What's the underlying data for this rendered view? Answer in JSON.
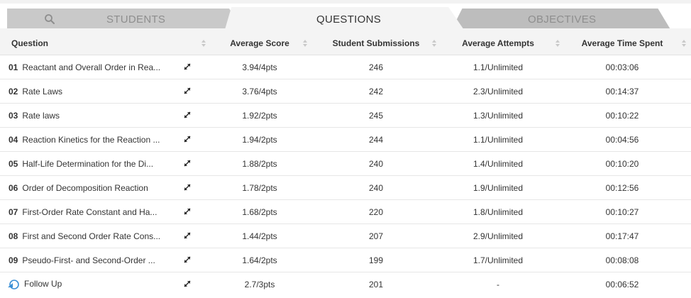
{
  "tabs": {
    "students": "STUDENTS",
    "questions": "QUESTIONS",
    "objectives": "OBJECTIVES"
  },
  "table": {
    "headers": {
      "question": "Question",
      "average_score": "Average Score",
      "student_submissions": "Student Submissions",
      "average_attempts": "Average Attempts",
      "average_time_spent": "Average Time Spent"
    },
    "rows": [
      {
        "num": "01",
        "title": "Reactant and Overall Order in Rea...",
        "score": "3.94/4pts",
        "submissions": "246",
        "attempts": "1.1/Unlimited",
        "time": "00:03:06"
      },
      {
        "num": "02",
        "title": "Rate Laws",
        "score": "3.76/4pts",
        "submissions": "242",
        "attempts": "2.3/Unlimited",
        "time": "00:14:37"
      },
      {
        "num": "03",
        "title": "Rate laws",
        "score": "1.92/2pts",
        "submissions": "245",
        "attempts": "1.3/Unlimited",
        "time": "00:10:22"
      },
      {
        "num": "04",
        "title": "Reaction Kinetics for the Reaction ...",
        "score": "1.94/2pts",
        "submissions": "244",
        "attempts": "1.1/Unlimited",
        "time": "00:04:56"
      },
      {
        "num": "05",
        "title": "Half-Life Determination for the Di...",
        "score": "1.88/2pts",
        "submissions": "240",
        "attempts": "1.4/Unlimited",
        "time": "00:10:20"
      },
      {
        "num": "06",
        "title": "Order of Decomposition Reaction",
        "score": "1.78/2pts",
        "submissions": "240",
        "attempts": "1.9/Unlimited",
        "time": "00:12:56"
      },
      {
        "num": "07",
        "title": "First-Order Rate Constant and Ha...",
        "score": "1.68/2pts",
        "submissions": "220",
        "attempts": "1.8/Unlimited",
        "time": "00:10:27"
      },
      {
        "num": "08",
        "title": "First and Second Order Rate Cons...",
        "score": "1.44/2pts",
        "submissions": "207",
        "attempts": "2.9/Unlimited",
        "time": "00:17:47"
      },
      {
        "num": "09",
        "title": "Pseudo-First- and Second-Order ...",
        "score": "1.64/2pts",
        "submissions": "199",
        "attempts": "1.7/Unlimited",
        "time": "00:08:08"
      }
    ],
    "follow_up": {
      "title": "Follow Up",
      "score": "2.7/3pts",
      "submissions": "201",
      "attempts": "-",
      "time": "00:06:52"
    }
  },
  "icons": {
    "search": "search-icon",
    "expand": "expand-icon",
    "sort": "sort-icon",
    "follow_up": "follow-up-icon"
  },
  "colors": {
    "active_tab": "#f4f4f4",
    "inactive_tab": "#c9c9c9",
    "follow_up_icon": "#3a8fd6"
  }
}
